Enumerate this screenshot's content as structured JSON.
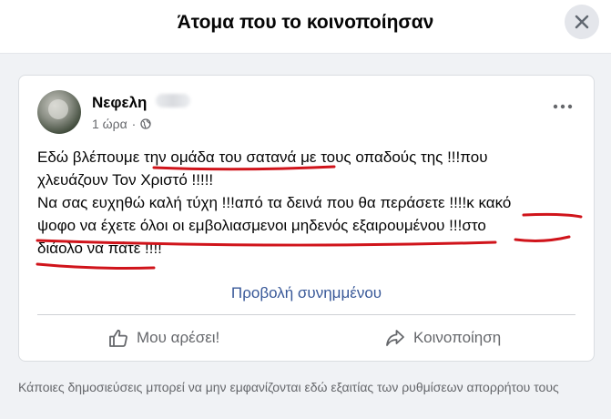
{
  "dialog": {
    "title": "Άτομα που το κοινοποίησαν",
    "close_icon": "close-icon"
  },
  "post": {
    "author": "Νεφελη",
    "time": "1 ώρα",
    "audience_icon": "globe-icon",
    "more_icon": "more-options-icon",
    "text": "Εδώ βλέπουμε την ομάδα του σατανά με τους οπαδούς της !!!που\nχλευάζουν Τον Χριστό !!!!!\nΝα σας ευχηθώ καλή τύχη !!!από τα δεινά που θα περάσετε !!!!κ κακό\nψοφο να έχετε όλοι οι εμβολιασμενοι μηδενός εξαιρουμένου !!!στο\nδιάολο να πάτε !!!!",
    "view_attachment": "Προβολή συνημμένου",
    "underline_color": "#d0141b"
  },
  "actions": {
    "like_label": "Μου αρέσει!",
    "like_icon": "thumbs-up-icon",
    "share_label": "Κοινοποίηση",
    "share_icon": "share-arrow-icon"
  },
  "footer": {
    "privacy_note": "Κάποιες δημοσιεύσεις μπορεί να μην εμφανίζονται εδώ εξαιτίας των ρυθμίσεων απορρήτου τους"
  },
  "colors": {
    "link": "#385898",
    "secondary_text": "#65676b",
    "feed_background": "#f0f2f5"
  }
}
